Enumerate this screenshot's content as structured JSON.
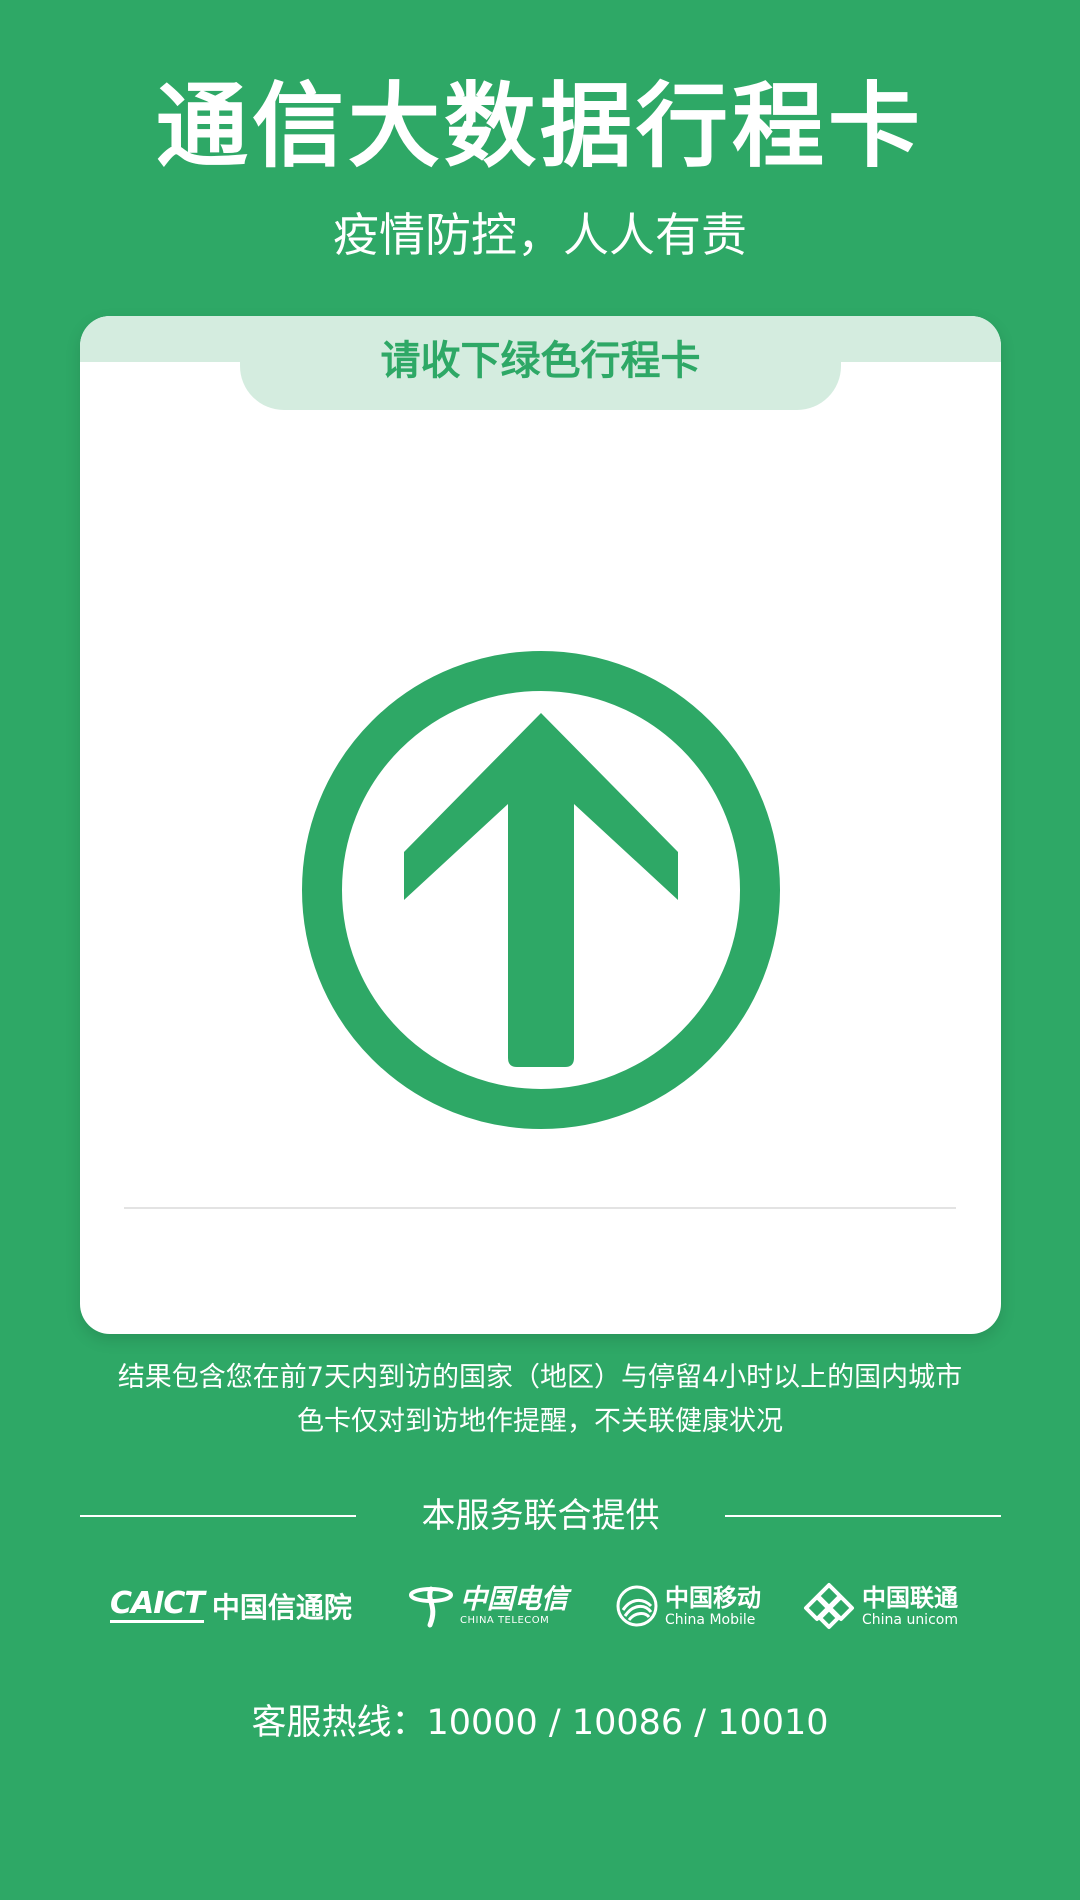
{
  "header": {
    "title": "通信大数据行程卡",
    "subtitle": "疫情防控，人人有责"
  },
  "card": {
    "tab_label": "请收下绿色行程卡",
    "status_color": "#2ea866",
    "status_icon": "up-arrow-circle-icon"
  },
  "note": {
    "line1": "结果包含您在前7天内到访的国家（地区）与停留4小时以上的国内城市",
    "line2": "色卡仅对到访地作提醒，不关联健康状况"
  },
  "footer": {
    "provided_by": "本服务联合提供",
    "logos": {
      "caict_mark": "CAICT",
      "caict_name": "中国信通院",
      "telecom_cn": "中国电信",
      "telecom_en": "CHINA TELECOM",
      "mobile_cn": "中国移动",
      "mobile_en": "China Mobile",
      "unicom_cn": "中国联通",
      "unicom_en": "China unicom"
    },
    "hotline": "客服热线：10000 / 10086 / 10010"
  },
  "theme": {
    "background": "#2ea866",
    "tab_background": "#d4ecdf"
  }
}
